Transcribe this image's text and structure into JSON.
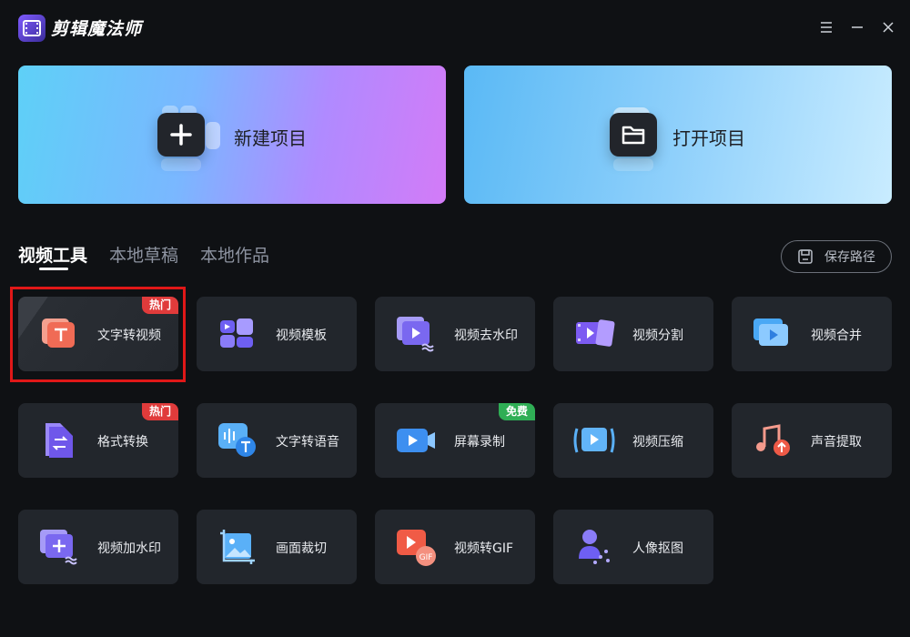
{
  "app": {
    "title": "剪辑魔法师",
    "logo_icon": "film-logo-icon"
  },
  "window_controls": [
    "menu-icon",
    "minimize-icon",
    "close-icon"
  ],
  "projects": {
    "new_label": "新建项目",
    "open_label": "打开项目"
  },
  "tabs": [
    {
      "label": "视频工具",
      "active": true
    },
    {
      "label": "本地草稿",
      "active": false
    },
    {
      "label": "本地作品",
      "active": false
    }
  ],
  "save_path": {
    "label": "保存路径",
    "icon": "save-icon"
  },
  "tools": [
    {
      "label": "文字转视频",
      "badge": "热门",
      "icon": "text-to-video-icon"
    },
    {
      "label": "视频模板",
      "badge": "",
      "icon": "template-icon"
    },
    {
      "label": "视频去水印",
      "badge": "",
      "icon": "remove-watermark-icon"
    },
    {
      "label": "视频分割",
      "badge": "",
      "icon": "video-split-icon"
    },
    {
      "label": "视频合并",
      "badge": "",
      "icon": "video-merge-icon"
    },
    {
      "label": "格式转换",
      "badge": "热门",
      "icon": "format-convert-icon"
    },
    {
      "label": "文字转语音",
      "badge": "",
      "icon": "text-to-speech-icon"
    },
    {
      "label": "屏幕录制",
      "badge": "免费",
      "icon": "screen-record-icon"
    },
    {
      "label": "视频压缩",
      "badge": "",
      "icon": "video-compress-icon"
    },
    {
      "label": "声音提取",
      "badge": "",
      "icon": "audio-extract-icon"
    },
    {
      "label": "视频加水印",
      "badge": "",
      "icon": "add-watermark-icon"
    },
    {
      "label": "画面裁切",
      "badge": "",
      "icon": "crop-icon"
    },
    {
      "label": "视频转GIF",
      "badge": "",
      "icon": "video-to-gif-icon"
    },
    {
      "label": "人像抠图",
      "badge": "",
      "icon": "portrait-cutout-icon"
    }
  ],
  "colors": {
    "background": "#0f1114",
    "card": "#22262c",
    "hot_badge": "#e03b3b",
    "free_badge": "#2fae55",
    "selection_outline": "#e01818"
  }
}
